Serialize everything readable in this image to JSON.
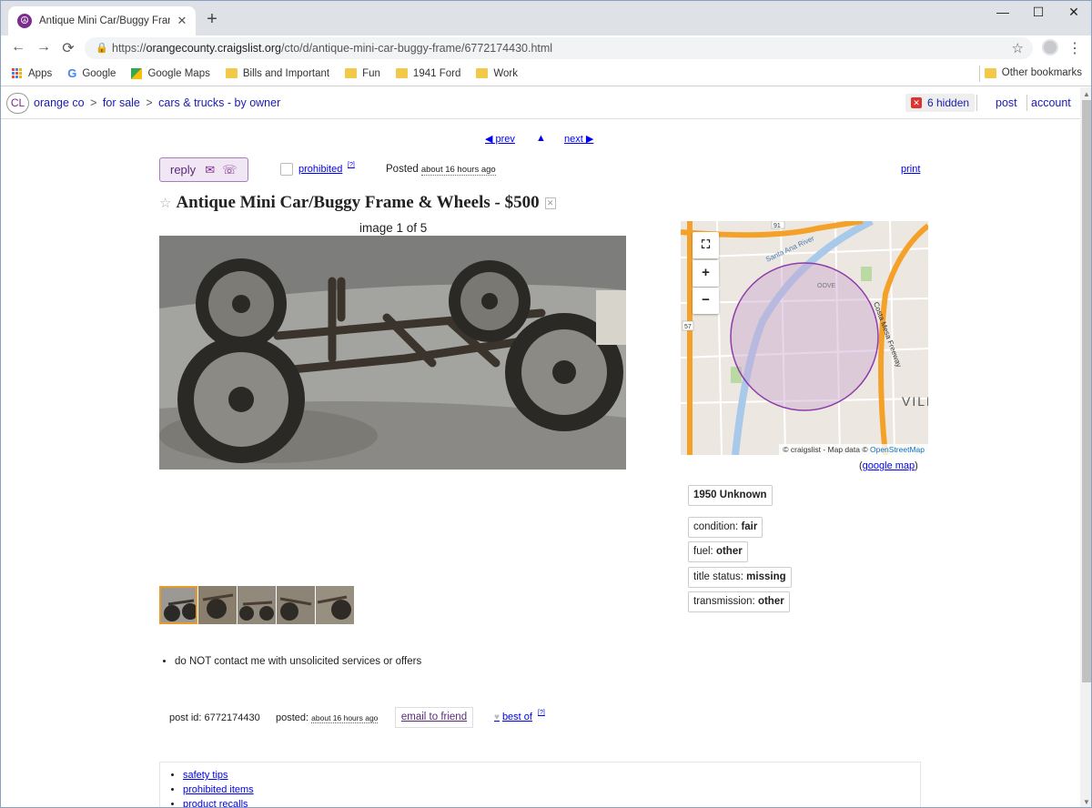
{
  "browser": {
    "tab_title": "Antique Mini Car/Buggy Frame &",
    "url_prefix": "https://",
    "url_host": "orangecounty.craigslist.org",
    "url_path": "/cto/d/antique-mini-car-buggy-frame/6772174430.html",
    "bookmarks": [
      "Apps",
      "Google",
      "Google Maps",
      "Bills and Important",
      "Fun",
      "1941 Ford",
      "Work"
    ],
    "other_bookmarks": "Other bookmarks"
  },
  "header": {
    "logo": "CL",
    "crumbs": [
      "orange co",
      "for sale",
      "cars & trucks - by owner"
    ],
    "crumb_sep": ">",
    "hidden": "6 hidden",
    "post": "post",
    "account": "account"
  },
  "nav": {
    "prev": "◀ prev",
    "up": "▲",
    "next": "next ▶"
  },
  "actions": {
    "reply": "reply",
    "prohibited": "prohibited",
    "prohibited_sup": "[?]",
    "posted_label": "Posted",
    "posted_time": "about 16 hours ago",
    "print": "print"
  },
  "listing": {
    "title": "Antique Mini Car/Buggy Frame & Wheels - $500",
    "image_count": "image 1 of 5",
    "notice": "do NOT contact me with unsolicited services or offers"
  },
  "map": {
    "labels": [
      "57",
      "91",
      "Santa Ana River",
      "OOVE",
      "Costa Mesa Freeway",
      "VILL"
    ],
    "attribution_pre": "© craigslist - Map data ©",
    "attribution_link": "OpenStreetMap",
    "google_map": "google map"
  },
  "attributes": {
    "year_model": "1950 Unknown",
    "condition_label": "condition:",
    "condition": "fair",
    "fuel_label": "fuel:",
    "fuel": "other",
    "title_label": "title status:",
    "title_status": "missing",
    "transmission_label": "transmission:",
    "transmission": "other"
  },
  "postinfo": {
    "post_id_label": "post id:",
    "post_id": "6772174430",
    "posted_label": "posted:",
    "posted_time": "about 16 hours ago",
    "email": "email to friend",
    "best_of": "best of",
    "best_of_sup": "[?]"
  },
  "footer": [
    "safety tips",
    "prohibited items",
    "product recalls"
  ],
  "colors": {
    "accent": "#7b2d8e",
    "link": "#0000ee",
    "map_circle": "#8e3ca8"
  }
}
